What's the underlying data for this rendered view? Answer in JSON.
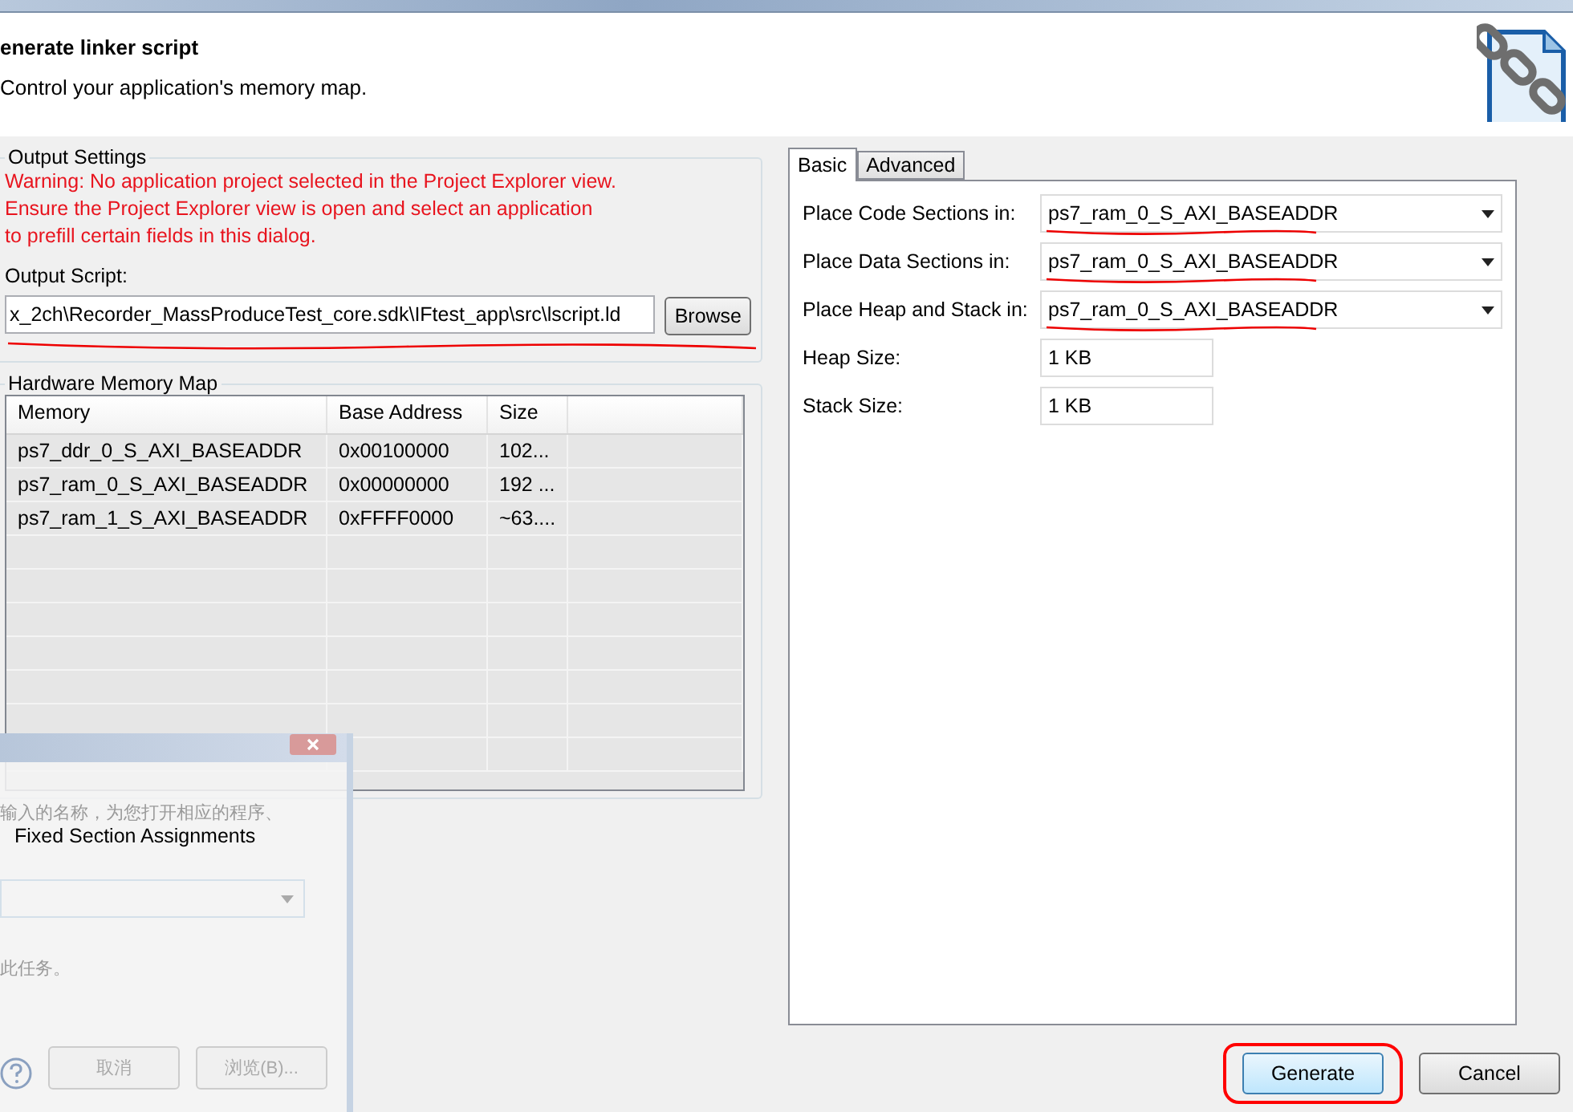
{
  "header": {
    "title": "enerate linker script",
    "subtitle": "Control your application's memory map."
  },
  "output_settings": {
    "title": "Output Settings",
    "warning": [
      "Warning: No application project selected in the Project Explorer view.",
      "Ensure the Project Explorer view is open and select an application",
      "to prefill certain fields in this dialog."
    ],
    "script_label": "Output Script:",
    "script_value": "x_2ch\\Recorder_MassProduceTest_core.sdk\\IFtest_app\\src\\lscript.ld",
    "script_marked": true,
    "browse": "Browse"
  },
  "memory_map": {
    "title": "Hardware Memory Map",
    "columns": [
      "Memory",
      "Base Address",
      "Size"
    ],
    "rows": [
      [
        "ps7_ddr_0_S_AXI_BASEADDR",
        "0x00100000",
        "102..."
      ],
      [
        "ps7_ram_0_S_AXI_BASEADDR",
        "0x00000000",
        "192 ..."
      ],
      [
        "ps7_ram_1_S_AXI_BASEADDR",
        "0xFFFF0000",
        "~63...."
      ]
    ]
  },
  "fixed_sections": {
    "title": "Fixed Section Assignments"
  },
  "tabs": [
    {
      "label": "Basic",
      "selected": true
    },
    {
      "label": "Advanced",
      "selected": false
    }
  ],
  "fields": [
    {
      "kind": "combo",
      "label": "Place Code Sections in:",
      "value": "ps7_ram_0_S_AXI_BASEADDR",
      "marked": true
    },
    {
      "kind": "combo",
      "label": "Place Data Sections in:",
      "value": "ps7_ram_0_S_AXI_BASEADDR",
      "marked": true
    },
    {
      "kind": "combo",
      "label": "Place Heap and Stack in:",
      "value": "ps7_ram_0_S_AXI_BASEADDR",
      "marked": true
    },
    {
      "kind": "text",
      "label": "Heap Size:",
      "value": "1 KB",
      "marked": false
    },
    {
      "kind": "text",
      "label": "Stack Size:",
      "value": "1 KB",
      "marked": false
    }
  ],
  "buttons": [
    {
      "label": "Generate",
      "default": true,
      "circled": true
    },
    {
      "label": "Cancel",
      "default": false,
      "circled": false
    }
  ],
  "ghost_dialog": {
    "lines": [
      "输入的名称，为您打开相应的程序、",
      "此任务。"
    ],
    "buttons": [
      "取消",
      "浏览(B)..."
    ]
  }
}
